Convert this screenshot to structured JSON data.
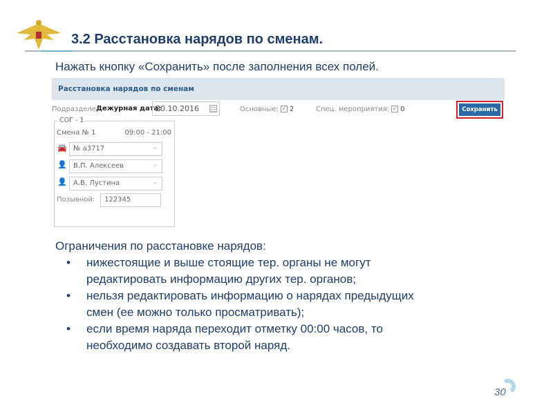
{
  "slide": {
    "title": "3.2 Расстановка нарядов по сменам.",
    "subtitle": "Нажать кнопку «Сохранить» после заполнения всех полей.",
    "page_number": "30",
    "accent": "#1f3d6b"
  },
  "app": {
    "header": "Расстановка нарядов по сменам",
    "subdivision_label": "Подразделение",
    "duty_date_label": "Дежурная дата:",
    "duty_date": "20.10.2016",
    "main_label": "Основные:",
    "main_count": "2",
    "special_label": "Спец. мероприятия:",
    "special_count": "0",
    "save_label": "Сохранить",
    "group": {
      "legend": "СОГ - 1",
      "shift": "Смена № 1",
      "time": "09:00 - 21:00",
      "vehicle": "№ а3717",
      "officer1": "В.П. Алексеев",
      "officer2": "А.В. Лустина",
      "callsign_label": "Позывной:",
      "callsign": "122345"
    },
    "save_highlight": "#d4202a"
  },
  "restrictions": {
    "heading": "Ограничения по расстановке нарядов:",
    "items": [
      "нижестоящие и выше стоящие тер. органы не могут редактировать информацию других тер. органов;",
      "нельзя редактировать информацию о нарядах предыдущих смен (ее можно только просматривать);",
      "если время наряда переходит отметку 00:00 часов, то необходимо создавать второй наряд."
    ]
  }
}
